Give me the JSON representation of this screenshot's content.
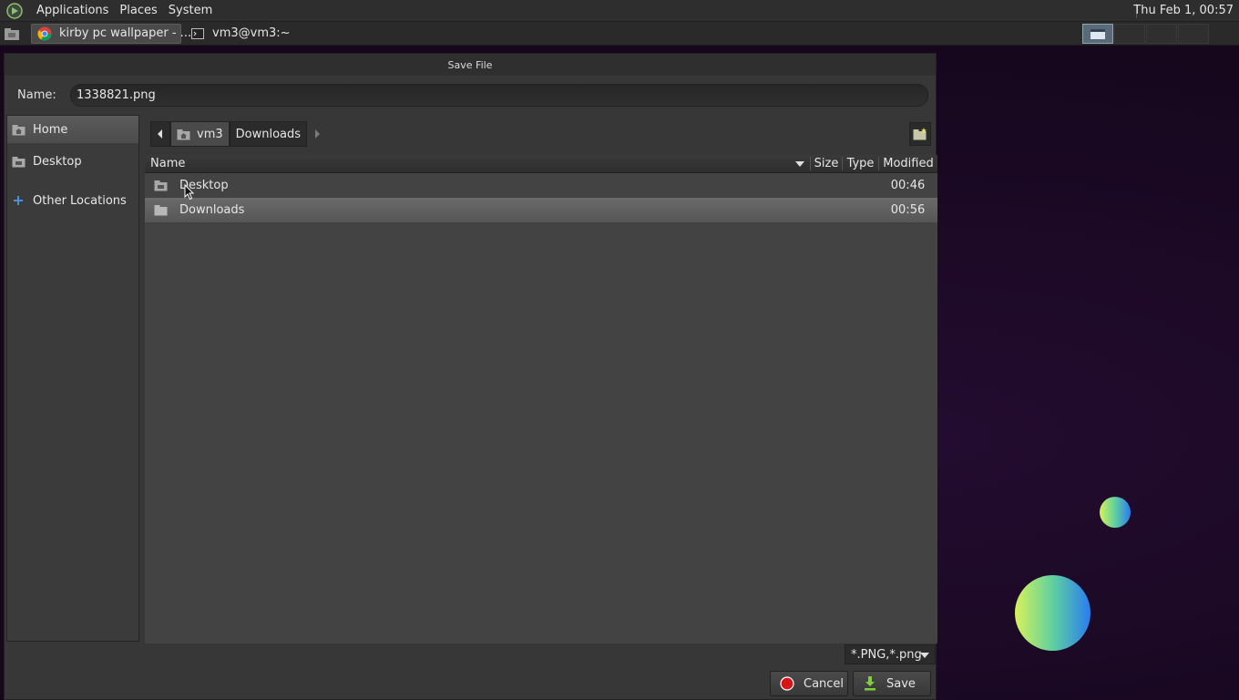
{
  "topbar": {
    "menus": [
      "Applications",
      "Places",
      "System"
    ],
    "clock": "Thu Feb  1, 00:57"
  },
  "taskbar": {
    "tasks": [
      {
        "label": "kirby pc wallpaper - ...",
        "icon": "chrome-icon",
        "active": true
      },
      {
        "label": "vm3@vm3:~",
        "icon": "terminal-icon",
        "active": false
      }
    ]
  },
  "dialog": {
    "title": "Save File",
    "name_label": "Name:",
    "name_value": "1338821.png",
    "sidebar": {
      "items": [
        {
          "label": "Home",
          "icon": "home-icon",
          "selected": true
        },
        {
          "label": "Desktop",
          "icon": "desktop-folder-icon",
          "selected": false
        },
        {
          "label": "Other Locations",
          "icon": "plus-icon",
          "selected": false
        }
      ]
    },
    "path": [
      "vm3",
      "Downloads"
    ],
    "columns": {
      "name": "Name",
      "size": "Size",
      "type": "Type",
      "modified": "Modified"
    },
    "rows": [
      {
        "name": "Desktop",
        "size": "",
        "type": "",
        "modified": "00:46",
        "selected": false
      },
      {
        "name": "Downloads",
        "size": "",
        "type": "",
        "modified": "00:56",
        "selected": true
      }
    ],
    "filter": "*.PNG,*.png",
    "cancel_label": "Cancel",
    "save_label": "Save"
  },
  "colors": {
    "dialog_bg": "#373737",
    "selected_row": "#5e5e5e",
    "desktop_bg": "#1b0a24",
    "cancel_red": "#d8141b",
    "save_green": "#7fcf3a"
  }
}
